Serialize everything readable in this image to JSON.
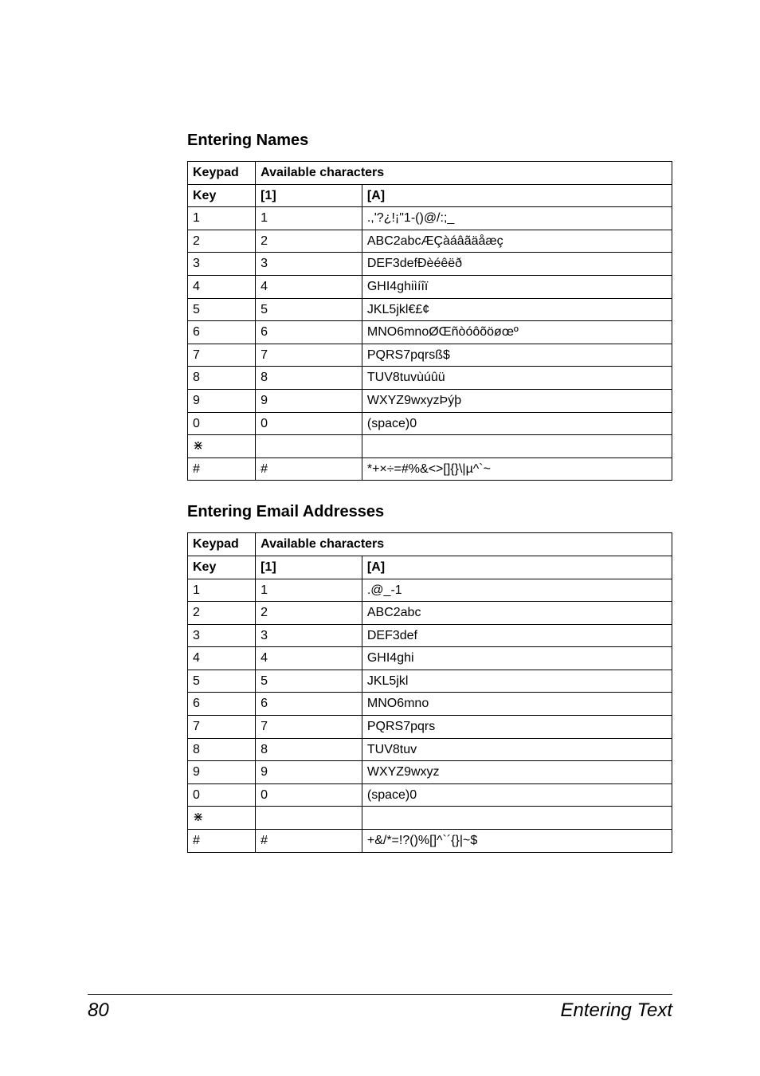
{
  "headings": {
    "names": "Entering Names",
    "emails": "Entering Email Addresses"
  },
  "tableHeaders": {
    "keypad": "Keypad",
    "key": "Key",
    "available": "Available characters",
    "mode1": "[1]",
    "modeA": "[A]"
  },
  "tableNames": {
    "rows": [
      {
        "key": "1",
        "one": "1",
        "a": ".,'?¿!¡\"1-()@/:;_"
      },
      {
        "key": "2",
        "one": "2",
        "a": "ABC2abcÆÇàáâãäåæç"
      },
      {
        "key": "3",
        "one": "3",
        "a": "DEF3defÐèéêëð"
      },
      {
        "key": "4",
        "one": "4",
        "a": "GHI4ghiìíîï"
      },
      {
        "key": "5",
        "one": "5",
        "a": "JKL5jkl€£¢"
      },
      {
        "key": "6",
        "one": "6",
        "a": "MNO6mnoØŒñòóôõöøœº"
      },
      {
        "key": "7",
        "one": "7",
        "a": "PQRS7pqrsß$"
      },
      {
        "key": "8",
        "one": "8",
        "a": "TUV8tuvùúûü"
      },
      {
        "key": "9",
        "one": "9",
        "a": "WXYZ9wxyzÞýþ"
      },
      {
        "key": "0",
        "one": "0",
        "a": "(space)0"
      },
      {
        "key": "⋇",
        "one": "",
        "a": ""
      },
      {
        "key": "#",
        "one": "#",
        "a": "*+×÷=#%&<>[]{}\\|µ^`~"
      }
    ]
  },
  "tableEmails": {
    "rows": [
      {
        "key": "1",
        "one": "1",
        "a": ".@_-1"
      },
      {
        "key": "2",
        "one": "2",
        "a": "ABC2abc"
      },
      {
        "key": "3",
        "one": "3",
        "a": "DEF3def"
      },
      {
        "key": "4",
        "one": "4",
        "a": "GHI4ghi"
      },
      {
        "key": "5",
        "one": "5",
        "a": "JKL5jkl"
      },
      {
        "key": "6",
        "one": "6",
        "a": "MNO6mno"
      },
      {
        "key": "7",
        "one": "7",
        "a": "PQRS7pqrs"
      },
      {
        "key": "8",
        "one": "8",
        "a": "TUV8tuv"
      },
      {
        "key": "9",
        "one": "9",
        "a": "WXYZ9wxyz"
      },
      {
        "key": "0",
        "one": "0",
        "a": "(space)0"
      },
      {
        "key": "⋇",
        "one": "",
        "a": ""
      },
      {
        "key": "#",
        "one": "#",
        "a": "+&/*=!?()%[]^`´{}|~$"
      }
    ]
  },
  "footer": {
    "pageNumber": "80",
    "sectionTitle": "Entering Text"
  }
}
